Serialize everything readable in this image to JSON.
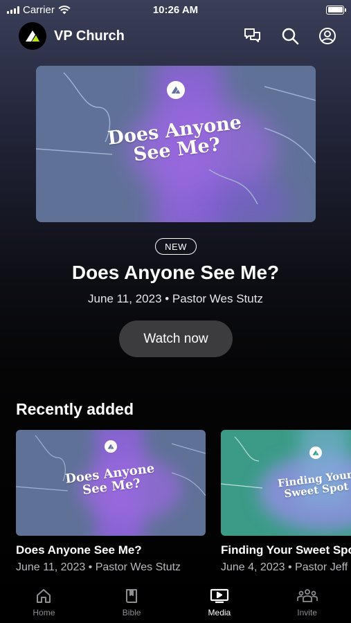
{
  "status_bar": {
    "carrier": "Carrier",
    "time": "10:26 AM"
  },
  "header": {
    "title": "VP Church"
  },
  "featured": {
    "art_title_line1": "Does Anyone",
    "art_title_line2": "See Me?",
    "badge": "NEW",
    "title": "Does Anyone See Me?",
    "meta": "June 11, 2023 • Pastor Wes Stutz",
    "watch_label": "Watch now"
  },
  "recently_added": {
    "heading": "Recently added",
    "items": [
      {
        "art_line1": "Does Anyone",
        "art_line2": "See Me?",
        "title": "Does Anyone See Me?",
        "meta": "June 11, 2023 • Pastor Wes Stutz"
      },
      {
        "art_line1": "Finding Your",
        "art_line2": "Sweet Spot",
        "title": "Finding Your Sweet Spot",
        "meta": "June 4, 2023 • Pastor Jeff"
      }
    ]
  },
  "tabs": [
    {
      "label": "Home",
      "icon": "home-icon",
      "active": false
    },
    {
      "label": "Bible",
      "icon": "bible-icon",
      "active": false
    },
    {
      "label": "Media",
      "icon": "media-icon",
      "active": true
    },
    {
      "label": "Invite",
      "icon": "invite-icon",
      "active": false
    }
  ],
  "colors": {
    "art_blue": "#5f7197",
    "art_purple": "#8e62d9",
    "art_teal": "#3b9b87",
    "active_tab": "#ffffff",
    "inactive_tab": "#8e8e93",
    "watch_button": "#3c3c3e"
  }
}
